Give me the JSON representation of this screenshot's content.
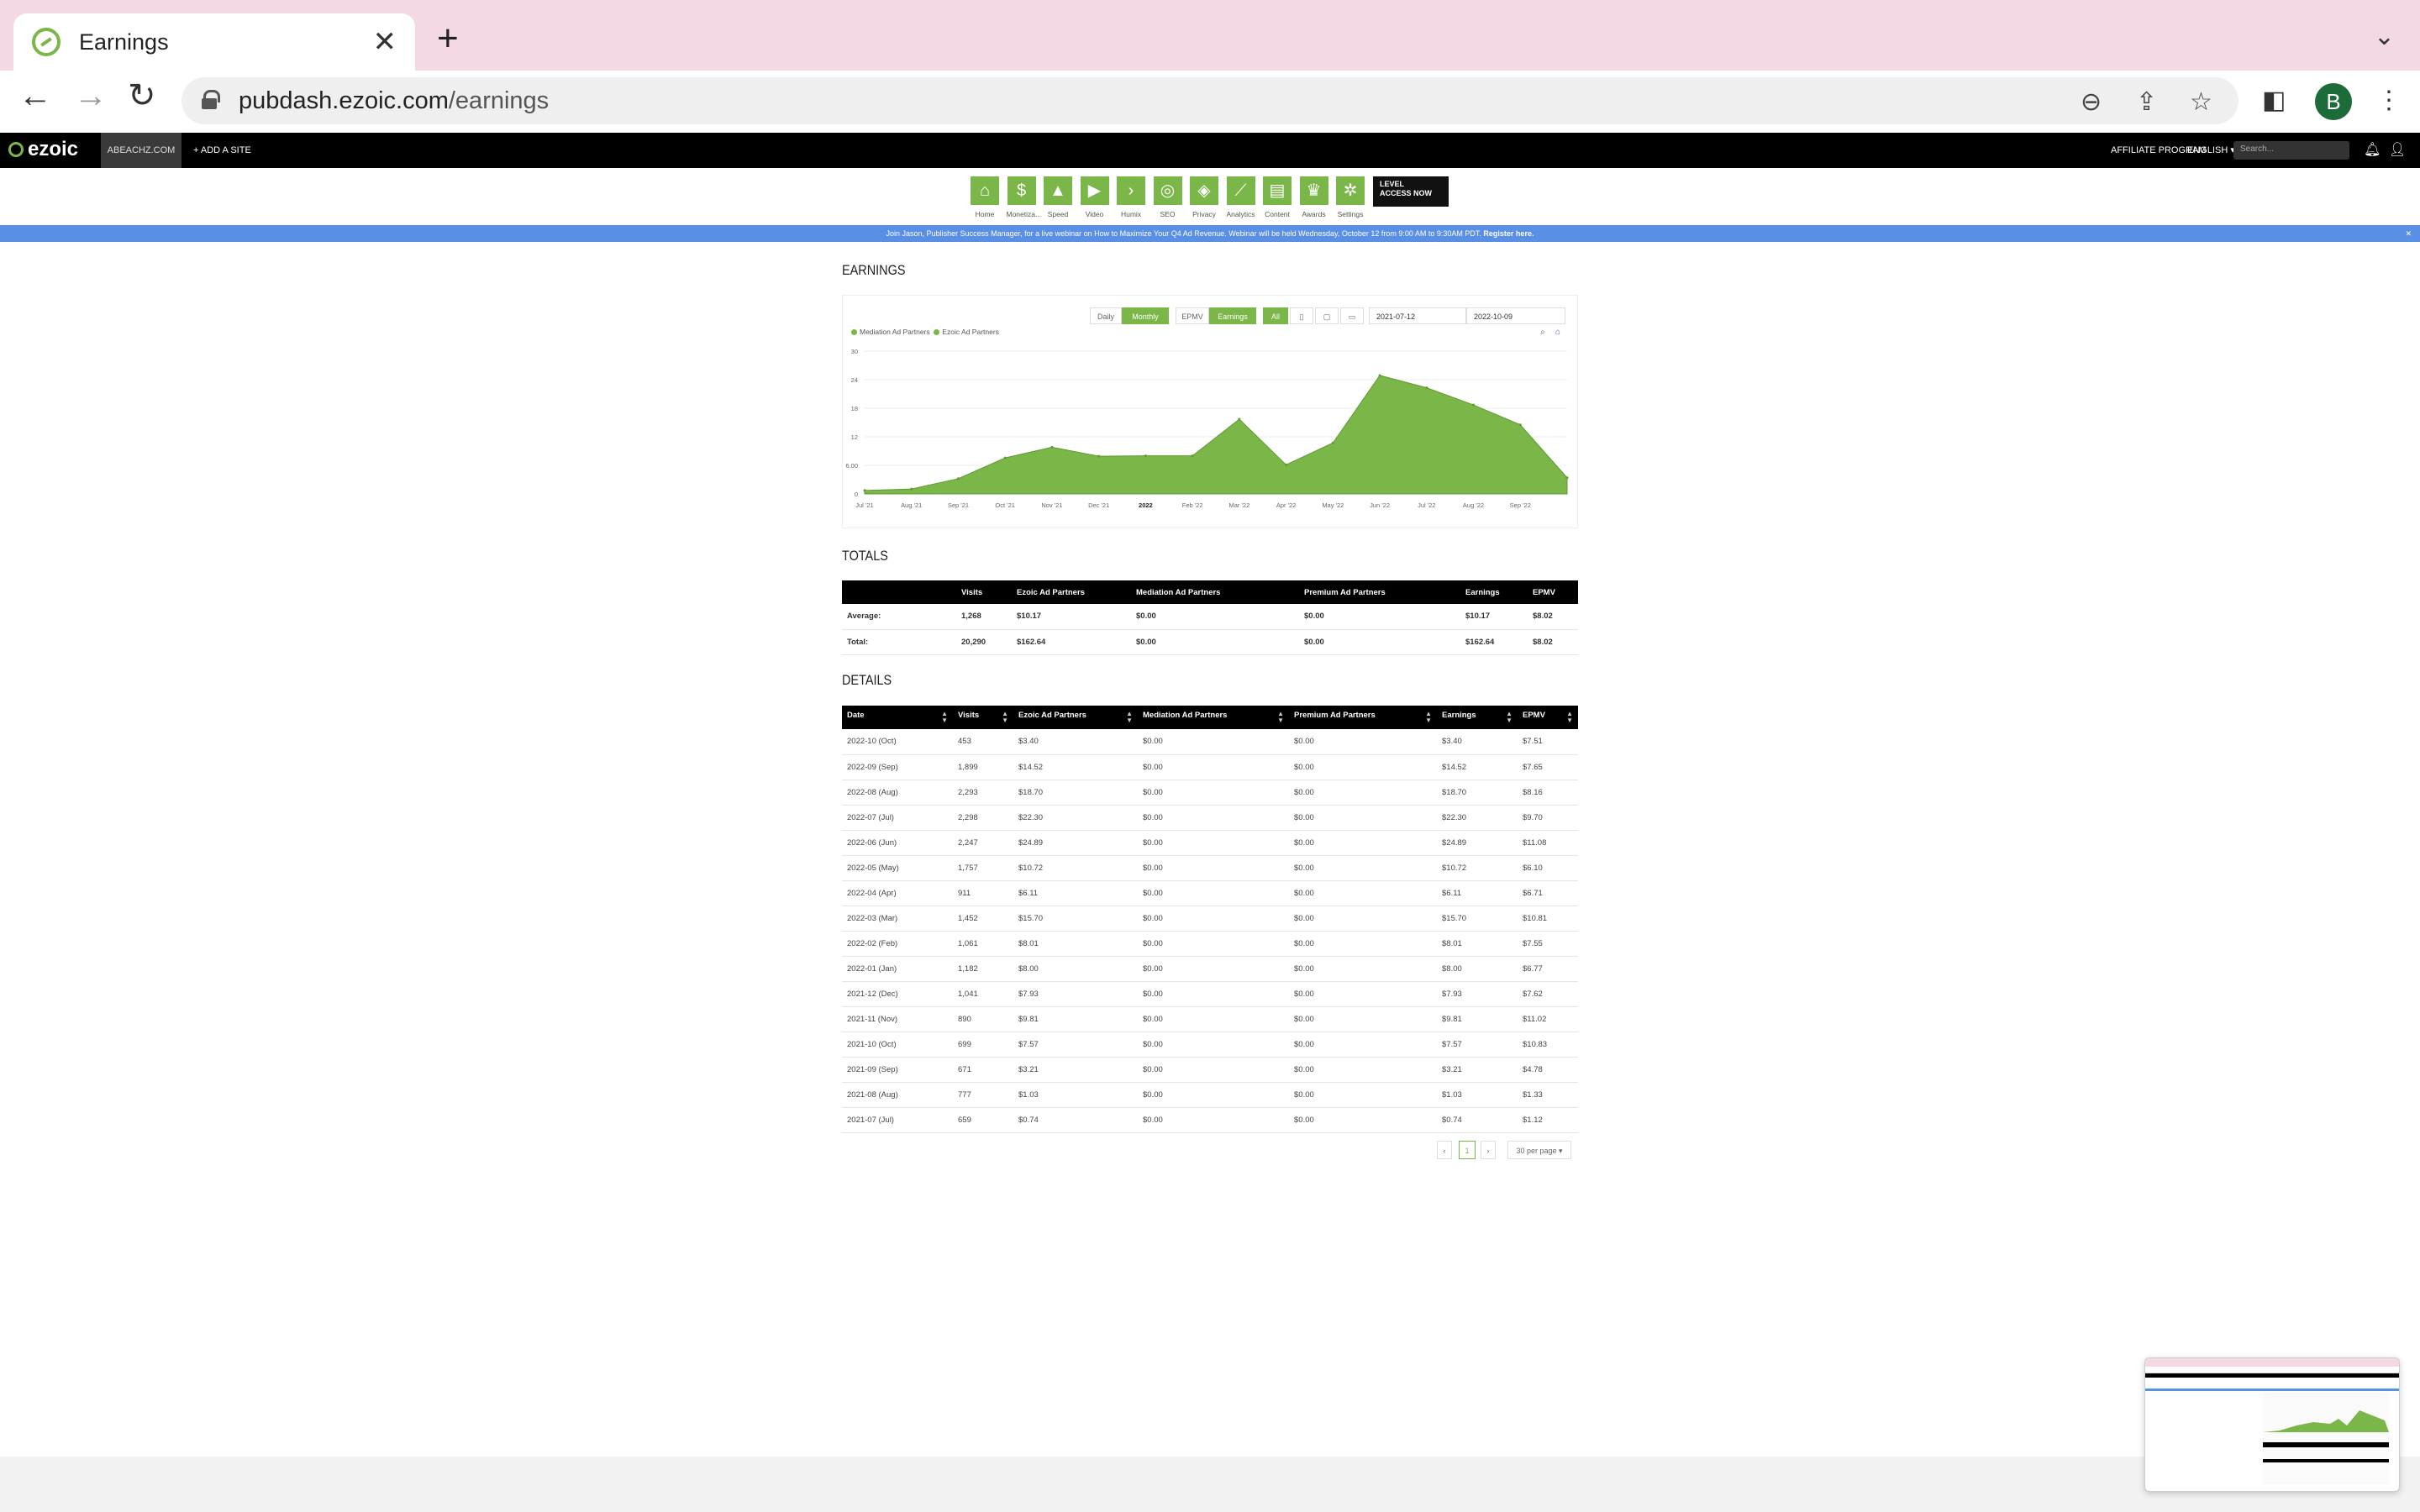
{
  "browser": {
    "tab_title": "Earnings",
    "url_host": "pubdash.ezoic.com",
    "url_path": "/earnings",
    "avatar_letter": "B"
  },
  "site_bar": {
    "logo": "ezoic",
    "site_name": "ABEACHZ.COM",
    "add_site": "+ ADD A SITE",
    "affiliate": "AFFILIATE PROGRAM",
    "language": "ENGLISH",
    "search_placeholder": "Search..."
  },
  "app_nav": [
    {
      "label": "Home",
      "icon": "home-icon",
      "glyph": "⌂"
    },
    {
      "label": "Monetiza...",
      "icon": "dollar-icon",
      "glyph": "$"
    },
    {
      "label": "Speed",
      "icon": "speed-icon",
      "glyph": "▲"
    },
    {
      "label": "Video",
      "icon": "video-icon",
      "glyph": "▶"
    },
    {
      "label": "Humix",
      "icon": "humix-icon",
      "glyph": "›"
    },
    {
      "label": "SEO",
      "icon": "seo-icon",
      "glyph": "◎"
    },
    {
      "label": "Privacy",
      "icon": "shield-icon",
      "glyph": "◈"
    },
    {
      "label": "Analytics",
      "icon": "analytics-icon",
      "glyph": "⟋"
    },
    {
      "label": "Content",
      "icon": "content-icon",
      "glyph": "▤"
    },
    {
      "label": "Awards",
      "icon": "trophy-icon",
      "glyph": "♛"
    },
    {
      "label": "Settings",
      "icon": "gear-icon",
      "glyph": "✲"
    }
  ],
  "lan_badge": {
    "line1": "LEVEL",
    "line2": "ACCESS NOW"
  },
  "announcement": {
    "text": "Join Jason, Publisher Success Manager, for a live webinar on How to Maximize Your Q4 Ad Revenue. Webinar will be held Wednesday, October 12 from 9:00 AM to 9:30AM PDT.",
    "link": "Register here."
  },
  "earnings": {
    "title": "EARNINGS",
    "controls": {
      "daily": "Daily",
      "monthly": "Monthly",
      "epmv": "EPMV",
      "earnings": "Earnings",
      "all": "All"
    },
    "start_date": "2021-07-12",
    "end_date": "2022-10-09",
    "legend": [
      "Mediation Ad Partners",
      "Ezoic Ad Partners"
    ]
  },
  "chart_data": {
    "type": "area",
    "title": "",
    "xlabel": "",
    "ylabel": "",
    "x": [
      "Jul '21",
      "Aug '21",
      "Sep '21",
      "Oct '21",
      "Nov '21",
      "Dec '21",
      "2022",
      "Feb '22",
      "Mar '22",
      "Apr '22",
      "May '22",
      "Jun '22",
      "Jul '22",
      "Aug '22",
      "Sep '22",
      "Oct '22"
    ],
    "x_ticks": [
      "Jul '21",
      "Aug '21",
      "Sep '21",
      "Oct '21",
      "Nov '21",
      "Dec '21",
      "2022",
      "Feb '22",
      "Mar '22",
      "Apr '22",
      "May '22",
      "Jun '22",
      "Jul '22",
      "Aug '22",
      "Sep '22"
    ],
    "y_ticks": [
      "0",
      "6.00",
      "12",
      "18",
      "24",
      "30"
    ],
    "ylim": [
      0,
      30
    ],
    "series": [
      {
        "name": "Ezoic Ad Partners",
        "color": "#7ab648",
        "values": [
          0.74,
          1.03,
          3.21,
          7.57,
          9.81,
          7.93,
          8.0,
          8.01,
          15.7,
          6.11,
          10.72,
          24.89,
          22.3,
          18.7,
          14.52,
          3.4
        ]
      },
      {
        "name": "Mediation Ad Partners",
        "color": "#8cc152",
        "values": [
          0,
          0,
          0,
          0,
          0,
          0,
          0,
          0,
          0,
          0,
          0,
          0,
          0,
          0,
          0,
          0
        ]
      }
    ],
    "grid": true
  },
  "totals": {
    "title": "TOTALS",
    "headers": [
      "",
      "Visits",
      "Ezoic Ad Partners",
      "Mediation Ad Partners",
      "Premium Ad Partners",
      "Earnings",
      "EPMV"
    ],
    "rows": [
      [
        "Average:",
        "1,268",
        "$10.17",
        "$0.00",
        "$0.00",
        "$10.17",
        "$8.02"
      ],
      [
        "Total:",
        "20,290",
        "$162.64",
        "$0.00",
        "$0.00",
        "$162.64",
        "$8.02"
      ]
    ]
  },
  "details": {
    "title": "DETAILS",
    "headers": [
      "Date",
      "Visits",
      "Ezoic Ad Partners",
      "Mediation Ad Partners",
      "Premium Ad Partners",
      "Earnings",
      "EPMV"
    ],
    "rows": [
      [
        "2022-10 (Oct)",
        "453",
        "$3.40",
        "$0.00",
        "$0.00",
        "$3.40",
        "$7.51"
      ],
      [
        "2022-09 (Sep)",
        "1,899",
        "$14.52",
        "$0.00",
        "$0.00",
        "$14.52",
        "$7.65"
      ],
      [
        "2022-08 (Aug)",
        "2,293",
        "$18.70",
        "$0.00",
        "$0.00",
        "$18.70",
        "$8.16"
      ],
      [
        "2022-07 (Jul)",
        "2,298",
        "$22.30",
        "$0.00",
        "$0.00",
        "$22.30",
        "$9.70"
      ],
      [
        "2022-06 (Jun)",
        "2,247",
        "$24.89",
        "$0.00",
        "$0.00",
        "$24.89",
        "$11.08"
      ],
      [
        "2022-05 (May)",
        "1,757",
        "$10.72",
        "$0.00",
        "$0.00",
        "$10.72",
        "$6.10"
      ],
      [
        "2022-04 (Apr)",
        "911",
        "$6.11",
        "$0.00",
        "$0.00",
        "$6.11",
        "$6.71"
      ],
      [
        "2022-03 (Mar)",
        "1,452",
        "$15.70",
        "$0.00",
        "$0.00",
        "$15.70",
        "$10.81"
      ],
      [
        "2022-02 (Feb)",
        "1,061",
        "$8.01",
        "$0.00",
        "$0.00",
        "$8.01",
        "$7.55"
      ],
      [
        "2022-01 (Jan)",
        "1,182",
        "$8.00",
        "$0.00",
        "$0.00",
        "$8.00",
        "$6.77"
      ],
      [
        "2021-12 (Dec)",
        "1,041",
        "$7.93",
        "$0.00",
        "$0.00",
        "$7.93",
        "$7.62"
      ],
      [
        "2021-11 (Nov)",
        "890",
        "$9.81",
        "$0.00",
        "$0.00",
        "$9.81",
        "$11.02"
      ],
      [
        "2021-10 (Oct)",
        "699",
        "$7.57",
        "$0.00",
        "$0.00",
        "$7.57",
        "$10.83"
      ],
      [
        "2021-09 (Sep)",
        "671",
        "$3.21",
        "$0.00",
        "$0.00",
        "$3.21",
        "$4.78"
      ],
      [
        "2021-08 (Aug)",
        "777",
        "$1.03",
        "$0.00",
        "$0.00",
        "$1.03",
        "$1.33"
      ],
      [
        "2021-07 (Jul)",
        "659",
        "$0.74",
        "$0.00",
        "$0.00",
        "$0.74",
        "$1.12"
      ]
    ],
    "pager": {
      "prev": "‹",
      "page": "1",
      "next": "›",
      "per_page": "30 per page"
    }
  }
}
